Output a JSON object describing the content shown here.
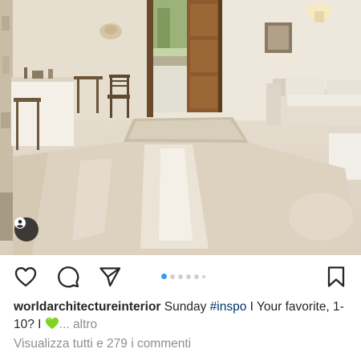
{
  "post": {
    "image_alt": "",
    "user_tag_icon": "person-icon",
    "carousel": {
      "count": 6,
      "active_index": 0
    }
  },
  "actions": {
    "like_icon": "heart-icon",
    "comment_icon": "comment-bubble-icon",
    "share_icon": "paper-plane-icon",
    "save_icon": "bookmark-icon"
  },
  "caption": {
    "username": "worldarchitectureinterior",
    "text_before_tag": " Sunday ",
    "hashtag": "#inspo",
    "text_after_tag": " I Your favorite, 1-10? I ",
    "emoji": "green-heart-emoji",
    "more": "... altro"
  },
  "comments": {
    "link": "Visualizza tutti e 279 i commenti"
  },
  "colors": {
    "accent": "#3897f0",
    "hashtag": "#00376b",
    "muted": "#8e8e8e",
    "text": "#262626",
    "emoji_green": "#7ed321"
  }
}
